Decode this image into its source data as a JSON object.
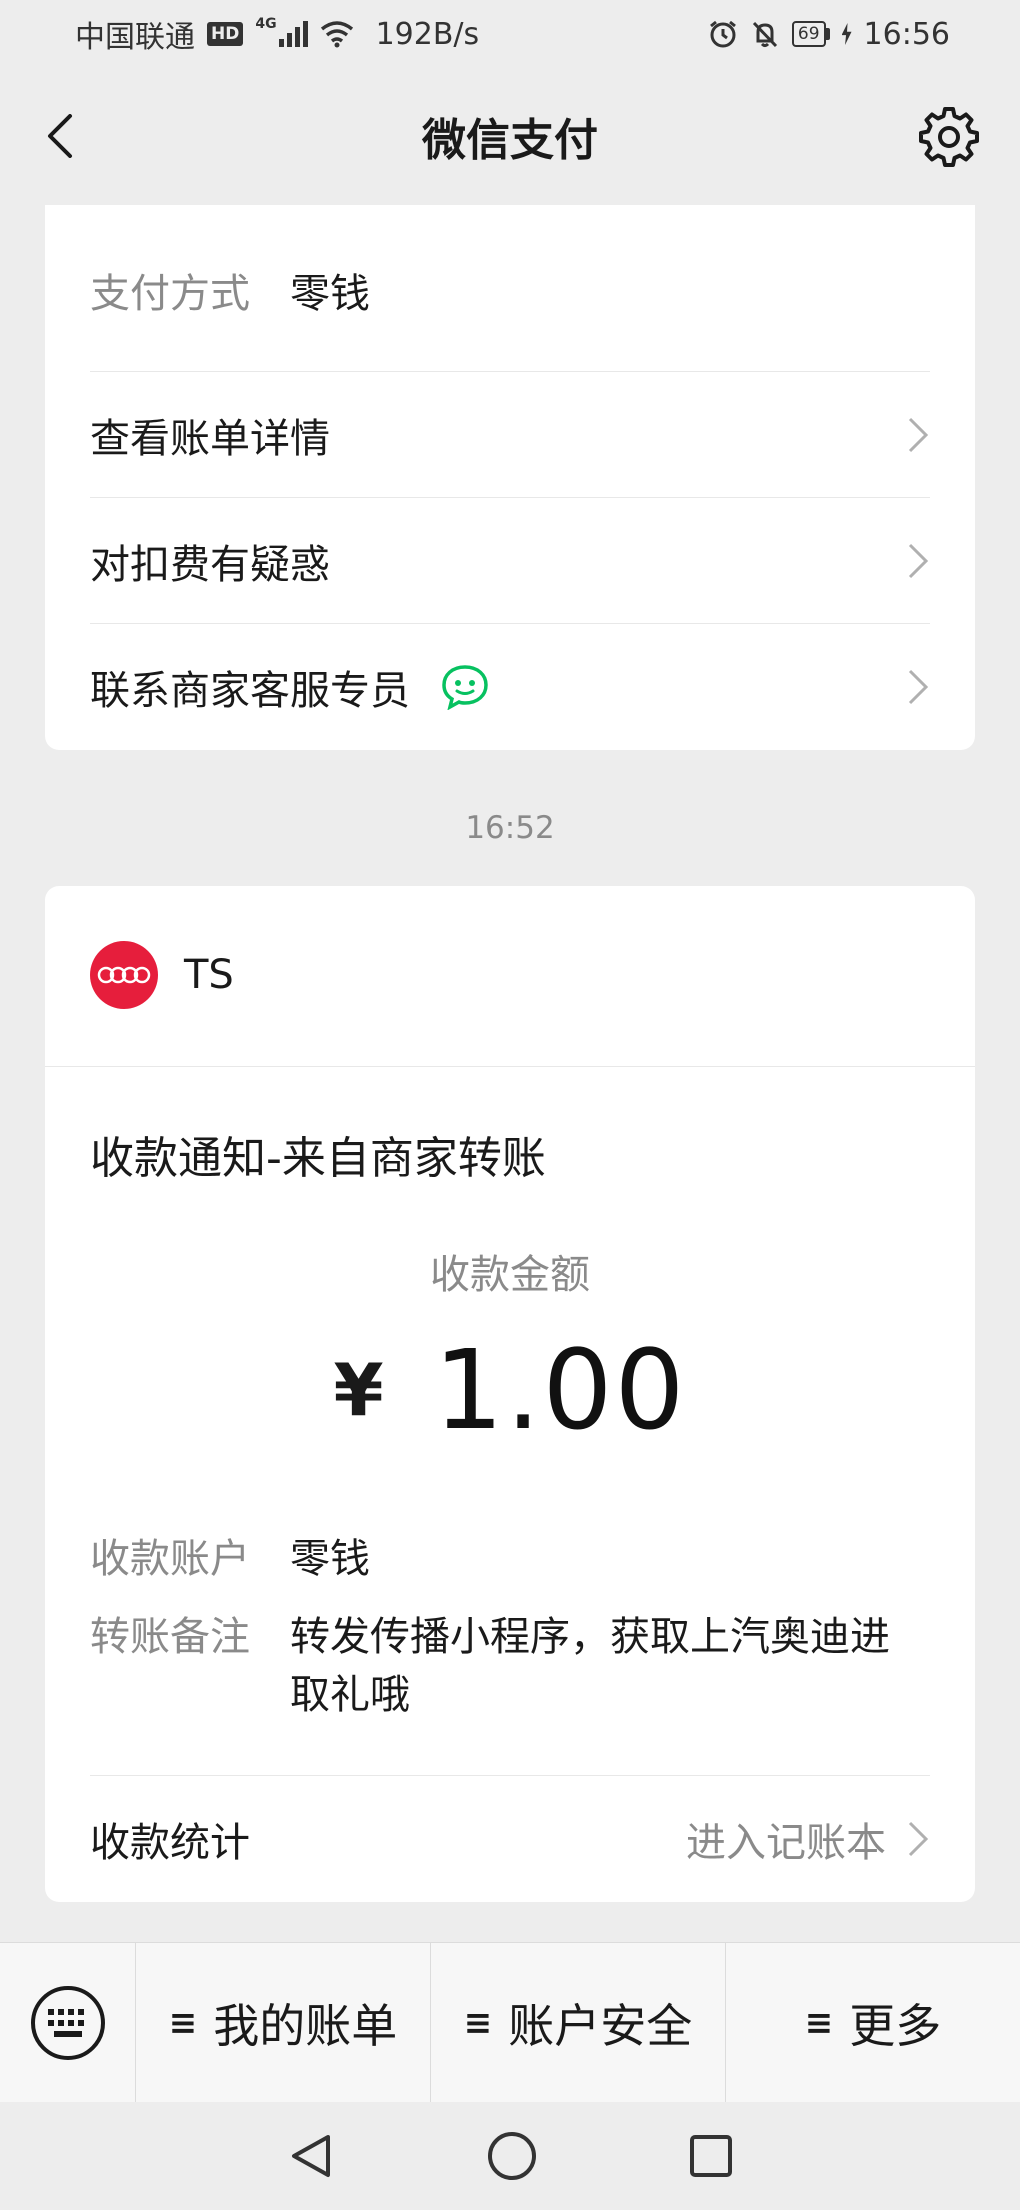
{
  "status_bar": {
    "carrier": "中国联通",
    "hd_badge": "HD",
    "network": "4G",
    "speed": "192B/s",
    "battery": "69",
    "time": "16:56"
  },
  "nav": {
    "title": "微信支付"
  },
  "payment_card": {
    "method_label": "支付方式",
    "method_value": "零钱",
    "links": [
      {
        "label": "查看账单详情"
      },
      {
        "label": "对扣费有疑惑"
      },
      {
        "label": "联系商家客服专员"
      }
    ]
  },
  "timestamp": "16:52",
  "receipt_card": {
    "merchant_name": "TS",
    "notice_title": "收款通知-来自商家转账",
    "amount_label": "收款金额",
    "currency": "¥",
    "amount": "1.00",
    "account_label": "收款账户",
    "account_value": "零钱",
    "remark_label": "转账备注",
    "remark_line1": "转发传播小程序，获取上汽奥迪进",
    "remark_line2": "取礼哦",
    "stats_label": "收款统计",
    "stats_link": "进入记账本"
  },
  "bottom_menu": {
    "lines_glyph": "≡",
    "items": [
      {
        "label": "我的账单"
      },
      {
        "label": "账户安全"
      },
      {
        "label": "更多"
      }
    ]
  },
  "colors": {
    "background": "#ededed",
    "card": "#ffffff",
    "wechat_green": "#07c160",
    "merchant_logo": "#e61e3c"
  }
}
